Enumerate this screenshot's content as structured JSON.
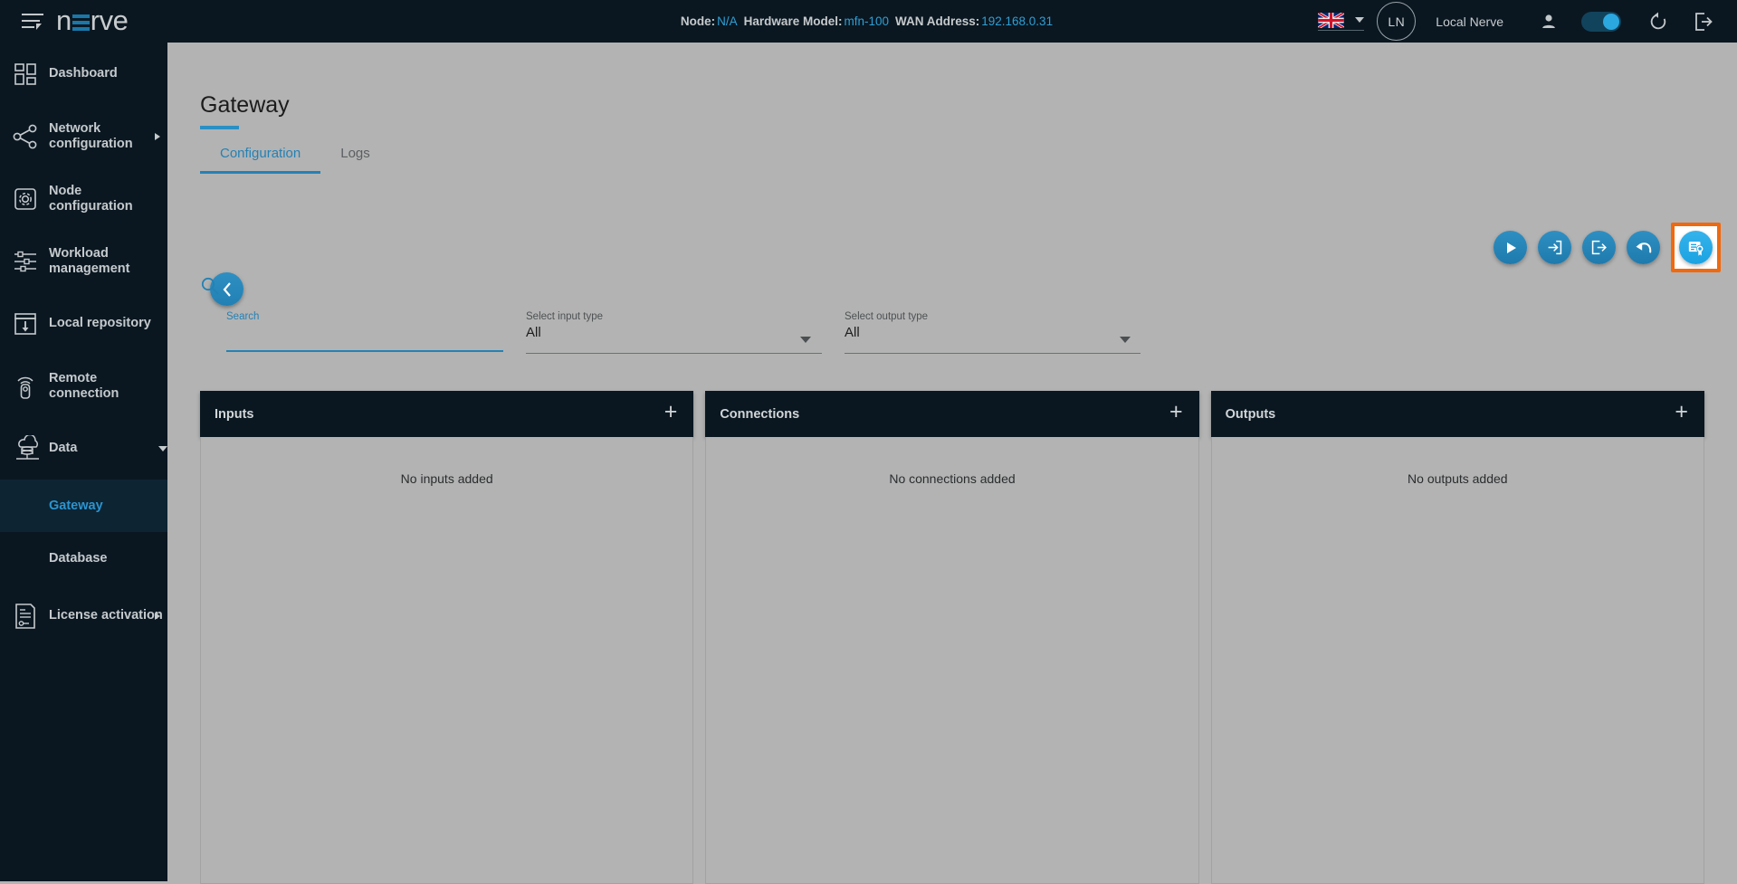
{
  "topbar": {
    "menu_icon": "hamburger-icon",
    "brand": {
      "pre": "n",
      "post": "rve"
    },
    "node_label": "Node:",
    "node_value": "N/A",
    "hardware_label": "Hardware Model:",
    "hardware_value": "mfn-100",
    "wan_label": "WAN Address:",
    "wan_value": "192.168.0.31",
    "language_flag": "uk-flag-icon",
    "avatar_initials": "LN",
    "user_name": "Local Nerve",
    "person_icon": "person-icon",
    "toggle_state": "on",
    "refresh_icon": "refresh-icon",
    "logout_icon": "logout-icon"
  },
  "sidebar": {
    "items": [
      {
        "label": "Dashboard",
        "icon": "dashboard-icon",
        "arrow": false
      },
      {
        "label": "Network configuration",
        "icon": "network-icon",
        "arrow": true
      },
      {
        "label": "Node configuration",
        "icon": "node-gear-icon",
        "arrow": false
      },
      {
        "label": "Workload management",
        "icon": "sliders-icon",
        "arrow": false
      },
      {
        "label": "Local repository",
        "icon": "repository-icon",
        "arrow": false
      },
      {
        "label": "Remote connection",
        "icon": "remote-icon",
        "arrow": false
      },
      {
        "label": "Data",
        "icon": "cloud-data-icon",
        "arrow": false,
        "caret": true
      }
    ],
    "sub_items": [
      {
        "label": "Gateway",
        "active": true
      },
      {
        "label": "Database",
        "active": false
      }
    ],
    "bottom_item": {
      "label": "License activation",
      "icon": "license-icon",
      "arrow": true
    }
  },
  "page": {
    "title": "Gateway",
    "tabs": [
      {
        "label": "Configuration",
        "active": true
      },
      {
        "label": "Logs",
        "active": false
      }
    ]
  },
  "toolbar": {
    "back_button": "back-icon",
    "actions": [
      {
        "name": "apply-button",
        "icon": "play-icon",
        "highlighted": false
      },
      {
        "name": "import-button",
        "icon": "import-icon",
        "highlighted": false
      },
      {
        "name": "export-button",
        "icon": "export-icon",
        "highlighted": false
      },
      {
        "name": "undo-button",
        "icon": "undo-icon",
        "highlighted": false
      },
      {
        "name": "certificate-button",
        "icon": "certificate-icon",
        "highlighted": true
      }
    ],
    "highlight_color": "#f0690f"
  },
  "filters": {
    "search": {
      "label": "Search",
      "value": "",
      "placeholder": ""
    },
    "input_type": {
      "label": "Select input type",
      "value": "All"
    },
    "output_type": {
      "label": "Select output type",
      "value": "All"
    }
  },
  "panels": [
    {
      "title": "Inputs",
      "empty_text": "No inputs added",
      "add_icon": "plus-icon"
    },
    {
      "title": "Connections",
      "empty_text": "No connections added",
      "add_icon": "plus-icon"
    },
    {
      "title": "Outputs",
      "empty_text": "No outputs added",
      "add_icon": "plus-icon"
    }
  ],
  "colors": {
    "accent": "#2581b4",
    "dark": "#0a1721",
    "page_bg": "#b3b3b3",
    "highlight": "#f0690f"
  }
}
